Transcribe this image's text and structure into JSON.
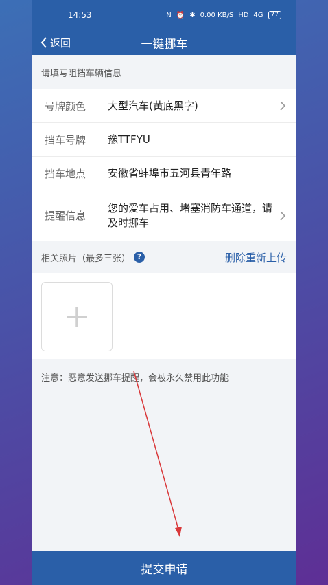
{
  "status_bar": {
    "time": "14:53",
    "net_speed": "0.00 KB/S",
    "hd": "HD",
    "signal": "4G",
    "battery": "77"
  },
  "navbar": {
    "back_label": "返回",
    "title": "一键挪车"
  },
  "form": {
    "hint": "请填写阻挡车辆信息",
    "rows": [
      {
        "label": "号牌颜色",
        "value": "大型汽车(黄底黑字)",
        "has_arrow": true
      },
      {
        "label": "挡车号牌",
        "value": "豫TTFYU",
        "has_arrow": false
      },
      {
        "label": "挡车地点",
        "value": "安徽省蚌埠市五河县青年路",
        "has_arrow": false
      },
      {
        "label": "提醒信息",
        "value": "您的爱车占用、堵塞消防车通道，请及时挪车",
        "has_arrow": true
      }
    ]
  },
  "photos": {
    "label": "相关照片（最多三张）",
    "reupload_label": "删除重新上传"
  },
  "notice": "注意：恶意发送挪车提醒，会被永久禁用此功能",
  "submit_label": "提交申请",
  "colors": {
    "primary": "#2a5fa8",
    "arrow": "#d9383a"
  },
  "icons": [
    "chevron-left-icon",
    "chevron-right-icon",
    "help-icon",
    "plus-icon"
  ]
}
